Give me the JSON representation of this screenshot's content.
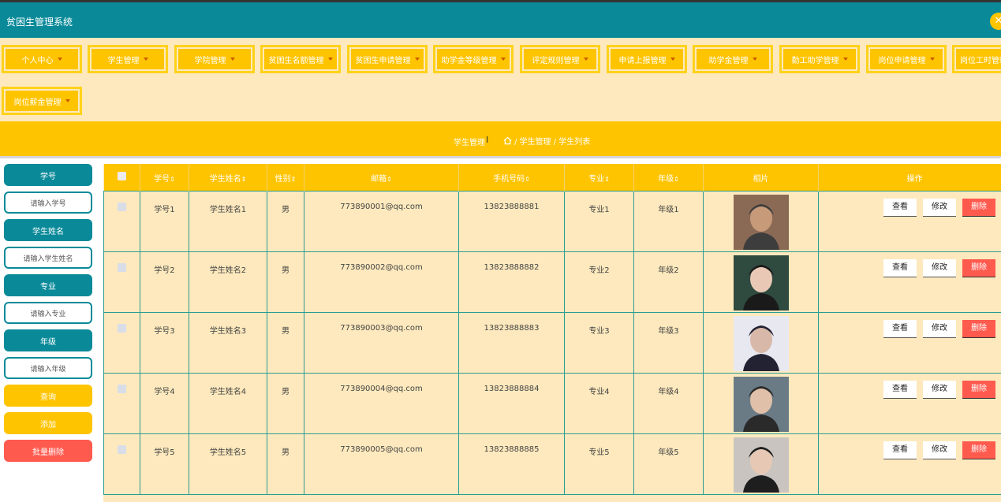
{
  "app": {
    "title": "贫困生管理系统",
    "close_icon": "close-icon"
  },
  "menu": {
    "row1": [
      "个人中心",
      "学生管理",
      "学院管理",
      "贫困生名额管理",
      "贫困生申请管理",
      "助学金等级管理",
      "评定规则管理",
      "申请上报管理",
      "助学金管理",
      "勤工助学管理",
      "岗位申请管理",
      "岗位工时管理"
    ],
    "row2": [
      "岗位薪金管理"
    ]
  },
  "breadcrumb": {
    "title": "学生管理",
    "path": "/ 学生管理 / 学生列表"
  },
  "search": {
    "fields": [
      {
        "label": "学号",
        "placeholder": "请输入学号"
      },
      {
        "label": "学生姓名",
        "placeholder": "请输入学生姓名"
      },
      {
        "label": "专业",
        "placeholder": "请输入专业"
      },
      {
        "label": "年级",
        "placeholder": "请输入年级"
      }
    ],
    "query_label": "查询",
    "add_label": "添加",
    "batch_delete_label": "批量删除"
  },
  "table": {
    "headers": [
      "学号",
      "学生姓名",
      "性别",
      "邮箱",
      "手机号码",
      "专业",
      "年级",
      "相片",
      "操作"
    ],
    "sort_mark": "⇕",
    "op_labels": {
      "view": "查看",
      "edit": "修改",
      "delete": "删除"
    },
    "rows": [
      {
        "id": "学号1",
        "name": "学生姓名1",
        "gender": "男",
        "email": "773890001@qq.com",
        "phone": "13823888881",
        "major": "专业1",
        "grade": "年级1"
      },
      {
        "id": "学号2",
        "name": "学生姓名2",
        "gender": "男",
        "email": "773890002@qq.com",
        "phone": "13823888882",
        "major": "专业2",
        "grade": "年级2"
      },
      {
        "id": "学号3",
        "name": "学生姓名3",
        "gender": "男",
        "email": "773890003@qq.com",
        "phone": "13823888883",
        "major": "专业3",
        "grade": "年级3"
      },
      {
        "id": "学号4",
        "name": "学生姓名4",
        "gender": "男",
        "email": "773890004@qq.com",
        "phone": "13823888884",
        "major": "专业4",
        "grade": "年级4"
      },
      {
        "id": "学号5",
        "name": "学生姓名5",
        "gender": "男",
        "email": "773890005@qq.com",
        "phone": "13823888885",
        "major": "专业5",
        "grade": "年级5"
      }
    ]
  },
  "colors": {
    "teal": "#0a8a99",
    "yellow": "#ffc400",
    "cream": "#fde9bd",
    "red": "#ff5a4e"
  }
}
